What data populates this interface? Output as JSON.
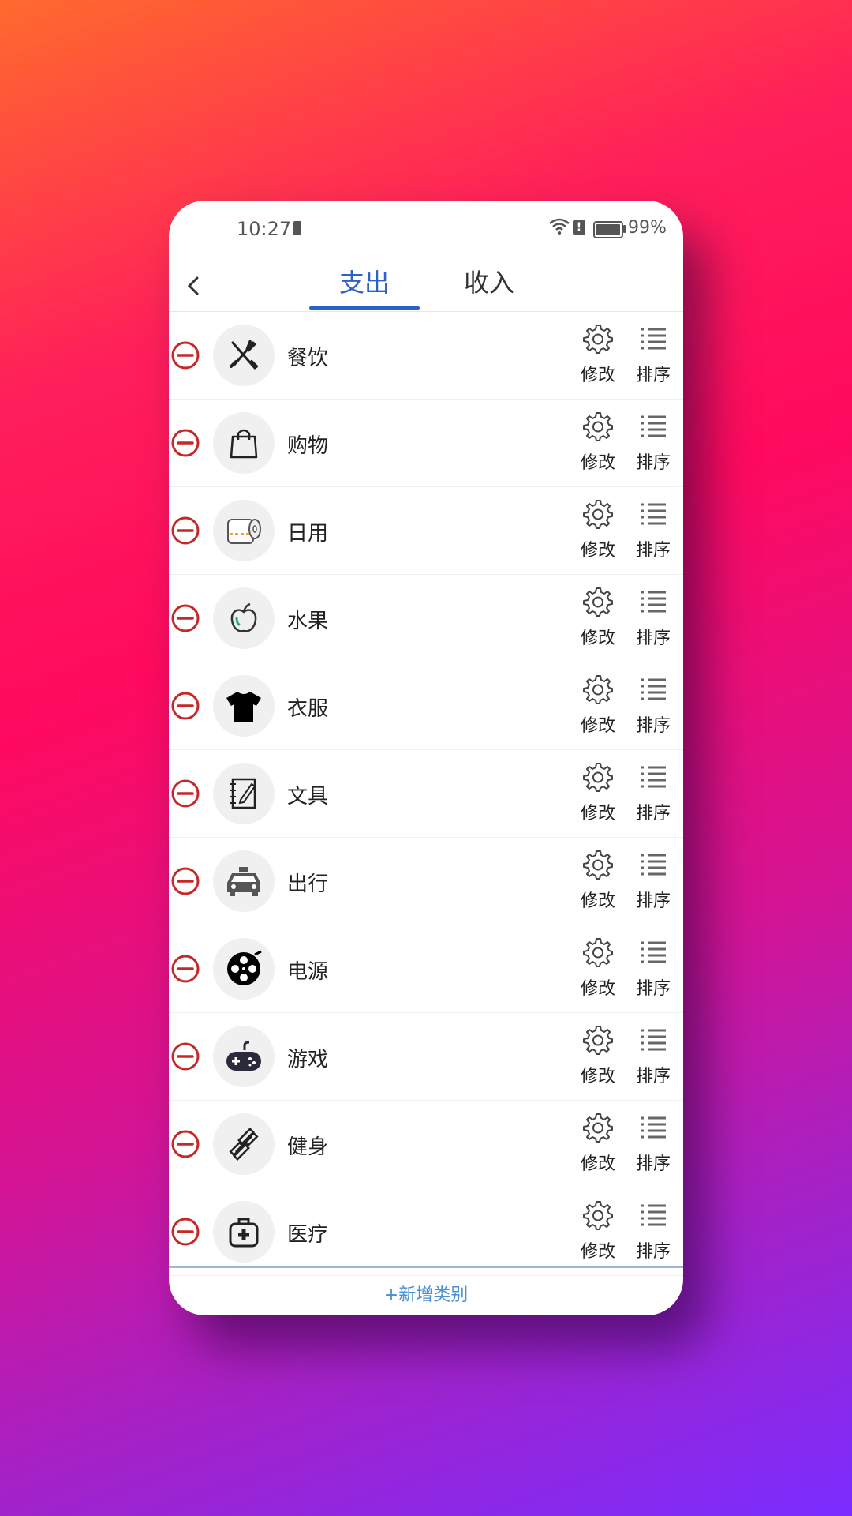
{
  "status": {
    "time": "10:27",
    "battery_pct": "99%"
  },
  "tabs": [
    {
      "label": "支出",
      "active": true
    },
    {
      "label": "收入",
      "active": false
    }
  ],
  "actions": {
    "edit": "修改",
    "sort": "排序"
  },
  "categories": [
    {
      "label": "餐饮",
      "icon": "fork-knife-icon"
    },
    {
      "label": "购物",
      "icon": "shopping-bag-icon"
    },
    {
      "label": "日用",
      "icon": "toilet-paper-icon"
    },
    {
      "label": "水果",
      "icon": "apple-icon"
    },
    {
      "label": "衣服",
      "icon": "tshirt-icon"
    },
    {
      "label": "文具",
      "icon": "notebook-pen-icon"
    },
    {
      "label": "出行",
      "icon": "taxi-icon"
    },
    {
      "label": "电源",
      "icon": "film-reel-icon"
    },
    {
      "label": "游戏",
      "icon": "gamepad-icon"
    },
    {
      "label": "健身",
      "icon": "dumbbell-icon"
    },
    {
      "label": "医疗",
      "icon": "medical-kit-icon"
    }
  ],
  "footer": {
    "add_label": "+新增类别"
  },
  "colors": {
    "accent": "#2a62c9",
    "remove": "#c62828",
    "link": "#4a90d6"
  }
}
